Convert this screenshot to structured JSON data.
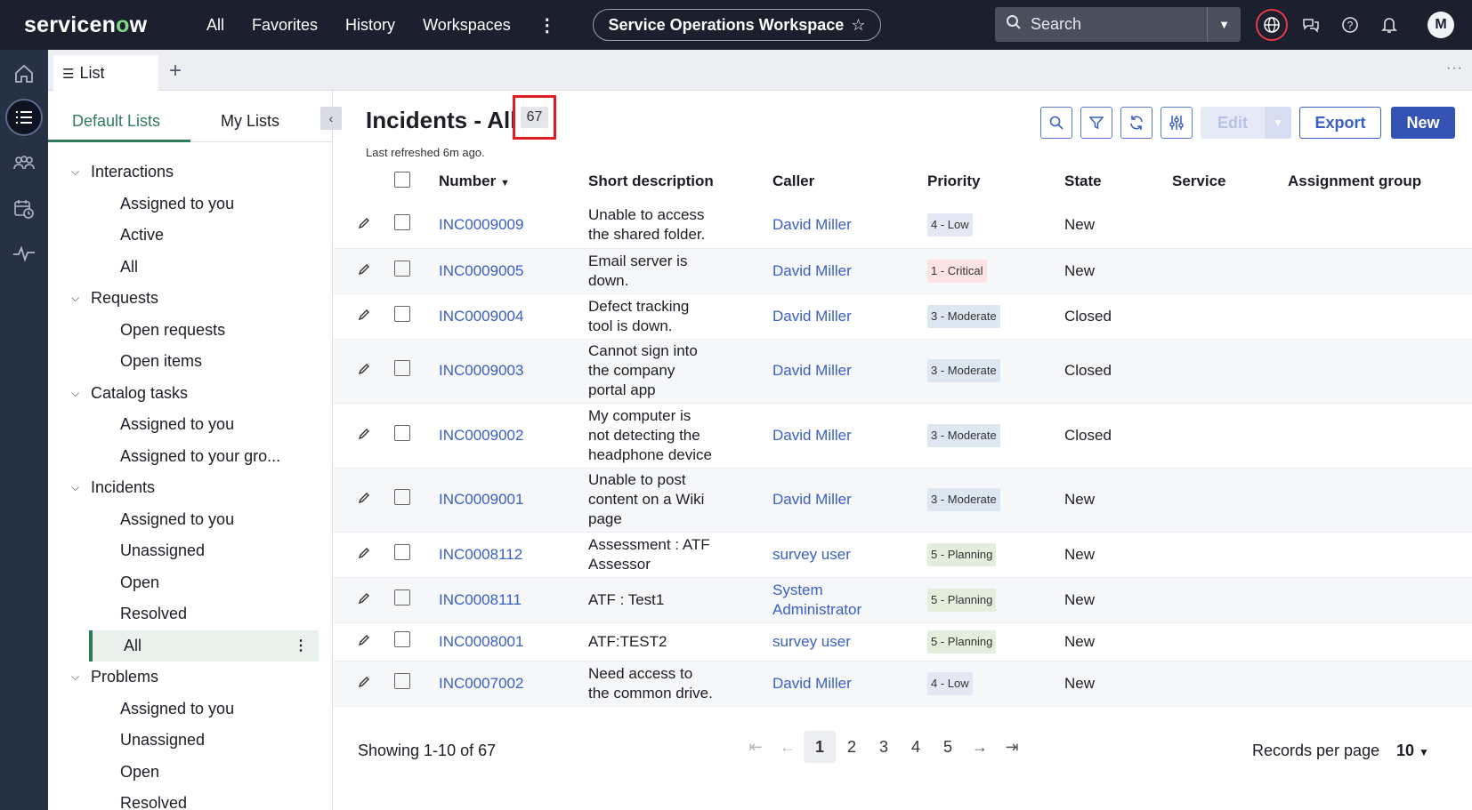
{
  "topbar": {
    "logo_pre": "servicen",
    "logo_o": "o",
    "logo_post": "w",
    "nav": [
      "All",
      "Favorites",
      "History",
      "Workspaces"
    ],
    "workspace": "Service Operations Workspace",
    "search_placeholder": "Search",
    "avatar_initial": "M"
  },
  "tabs": {
    "list_tab": "List"
  },
  "sidebar": {
    "tab_default": "Default Lists",
    "tab_my": "My Lists",
    "rows": [
      {
        "type": "group",
        "label": "Interactions"
      },
      {
        "type": "item",
        "label": "Assigned to you"
      },
      {
        "type": "item",
        "label": "Active"
      },
      {
        "type": "item",
        "label": "All"
      },
      {
        "type": "group",
        "label": "Requests"
      },
      {
        "type": "item",
        "label": "Open requests"
      },
      {
        "type": "item",
        "label": "Open items"
      },
      {
        "type": "group",
        "label": "Catalog tasks"
      },
      {
        "type": "item",
        "label": "Assigned to you"
      },
      {
        "type": "item",
        "label": "Assigned to your gro..."
      },
      {
        "type": "group",
        "label": "Incidents"
      },
      {
        "type": "item",
        "label": "Assigned to you"
      },
      {
        "type": "item",
        "label": "Unassigned"
      },
      {
        "type": "item",
        "label": "Open"
      },
      {
        "type": "item",
        "label": "Resolved"
      },
      {
        "type": "item",
        "label": "All",
        "selected": true
      },
      {
        "type": "group",
        "label": "Problems"
      },
      {
        "type": "item",
        "label": "Assigned to you"
      },
      {
        "type": "item",
        "label": "Unassigned"
      },
      {
        "type": "item",
        "label": "Open"
      },
      {
        "type": "item",
        "label": "Resolved"
      }
    ]
  },
  "main": {
    "title": "Incidents - All",
    "count": "67",
    "refreshed": "Last refreshed 6m ago.",
    "toolbar": {
      "edit": "Edit",
      "export": "Export",
      "new": "New"
    },
    "columns": {
      "number": "Number",
      "short_description": "Short description",
      "caller": "Caller",
      "priority": "Priority",
      "state": "State",
      "service": "Service",
      "assignment_group": "Assignment group"
    },
    "rows": [
      {
        "number": "INC0009009",
        "desc": [
          "Unable to access",
          "the shared folder."
        ],
        "caller": [
          "David Miller"
        ],
        "priority": "4 - Low",
        "pclass": "p-low",
        "state": "New"
      },
      {
        "number": "INC0009005",
        "desc": [
          "Email server is",
          "down."
        ],
        "caller": [
          "David Miller"
        ],
        "priority": "1 - Critical",
        "pclass": "p-crit",
        "state": "New"
      },
      {
        "number": "INC0009004",
        "desc": [
          "Defect tracking",
          "tool is down."
        ],
        "caller": [
          "David Miller"
        ],
        "priority": "3 - Moderate",
        "pclass": "p-mod",
        "state": "Closed"
      },
      {
        "number": "INC0009003",
        "desc": [
          "Cannot sign into",
          "the company",
          "portal app"
        ],
        "caller": [
          "David Miller"
        ],
        "priority": "3 - Moderate",
        "pclass": "p-mod",
        "state": "Closed"
      },
      {
        "number": "INC0009002",
        "desc": [
          "My computer is",
          "not detecting the",
          "headphone device"
        ],
        "caller": [
          "David Miller"
        ],
        "priority": "3 - Moderate",
        "pclass": "p-mod",
        "state": "Closed"
      },
      {
        "number": "INC0009001",
        "desc": [
          "Unable to post",
          "content on a Wiki",
          "page"
        ],
        "caller": [
          "David Miller"
        ],
        "priority": "3 - Moderate",
        "pclass": "p-mod",
        "state": "New"
      },
      {
        "number": "INC0008112",
        "desc": [
          "Assessment : ATF",
          "Assessor"
        ],
        "caller": [
          "survey user"
        ],
        "priority": "5 - Planning",
        "pclass": "p-plan",
        "state": "New"
      },
      {
        "number": "INC0008111",
        "desc": [
          "ATF : Test1"
        ],
        "caller": [
          "System",
          "Administrator"
        ],
        "priority": "5 - Planning",
        "pclass": "p-plan",
        "state": "New"
      },
      {
        "number": "INC0008001",
        "desc": [
          "ATF:TEST2"
        ],
        "caller": [
          "survey user"
        ],
        "priority": "5 - Planning",
        "pclass": "p-plan",
        "state": "New"
      },
      {
        "number": "INC0007002",
        "desc": [
          "Need access to",
          "the common drive."
        ],
        "caller": [
          "David Miller"
        ],
        "priority": "4 - Low",
        "pclass": "p-low",
        "state": "New"
      }
    ],
    "footer": {
      "showing": "Showing 1-10 of 67",
      "pages": [
        "1",
        "2",
        "3",
        "4",
        "5"
      ],
      "current_page": "1",
      "rpp_label": "Records per page",
      "rpp_value": "10"
    }
  }
}
